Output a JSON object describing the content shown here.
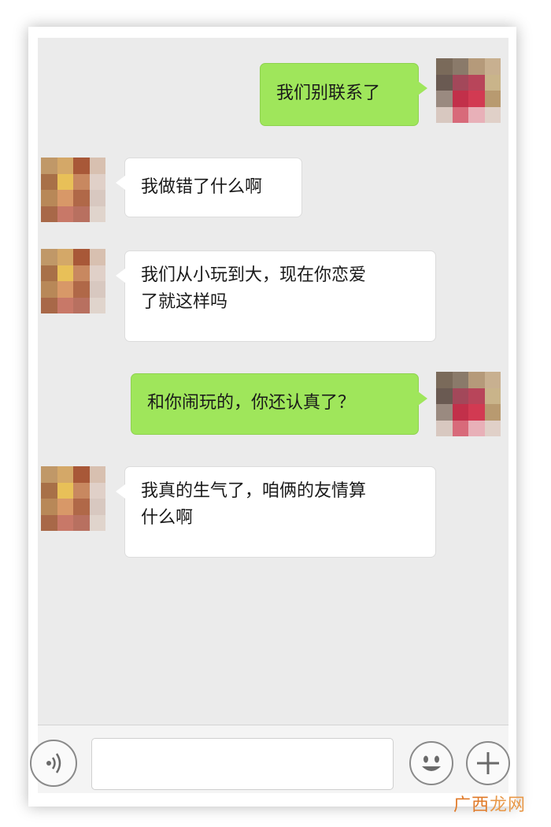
{
  "chat": {
    "messages": [
      {
        "side": "sent",
        "text": "我们别联系了"
      },
      {
        "side": "recv",
        "text": "我做错了什么啊"
      },
      {
        "side": "recv",
        "line1": "我们从小玩到大，现在你恋爱",
        "line2": "了就这样吗"
      },
      {
        "side": "sent",
        "text": "和你闹玩的，你还认真了？"
      },
      {
        "side": "recv",
        "line1": "我真的生气了，咱俩的友情算",
        "line2": "什么啊"
      }
    ]
  },
  "input_bar": {
    "voice_icon": "voice-icon",
    "emoji_icon": "emoji-icon",
    "plus_icon": "plus-icon",
    "message_value": ""
  },
  "watermark": {
    "part1": "广西",
    "part2": "龙网"
  },
  "colors": {
    "sent_bubble": "#9fe65b",
    "received_bubble": "#ffffff",
    "chat_background": "#ebebeb",
    "watermark": "#e07a28"
  }
}
